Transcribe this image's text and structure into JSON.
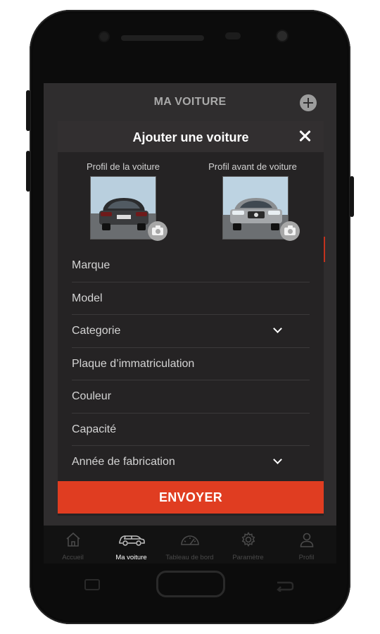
{
  "header": {
    "title": "MA VOITURE"
  },
  "modal": {
    "title": "Ajouter une voiture",
    "photos": [
      {
        "label": "Profil de la voiture",
        "icon": "car-rear-photo"
      },
      {
        "label": "Profil avant de voiture",
        "icon": "car-front-photo"
      }
    ],
    "fields": [
      {
        "label": "Marque",
        "dropdown": false
      },
      {
        "label": "Model",
        "dropdown": false
      },
      {
        "label": "Categorie",
        "dropdown": true
      },
      {
        "label": "Plaque d’immatriculation",
        "dropdown": false
      },
      {
        "label": "Couleur",
        "dropdown": false
      },
      {
        "label": "Capacité",
        "dropdown": false
      },
      {
        "label": "Année de fabrication",
        "dropdown": true
      }
    ],
    "submit_label": "ENVOYER"
  },
  "tabs": [
    {
      "label": "Accueil",
      "icon": "home-icon",
      "active": false
    },
    {
      "label": "Ma voiture",
      "icon": "car-icon",
      "active": true
    },
    {
      "label": "Tableau de bord",
      "icon": "dashboard-icon",
      "active": false
    },
    {
      "label": "Paramètre",
      "icon": "gear-icon",
      "active": false
    },
    {
      "label": "Profil",
      "icon": "user-icon",
      "active": false
    }
  ],
  "colors": {
    "accent": "#e03d21",
    "background": "#2f2d2e",
    "modal": "#252324",
    "tabbar": "#121212"
  }
}
